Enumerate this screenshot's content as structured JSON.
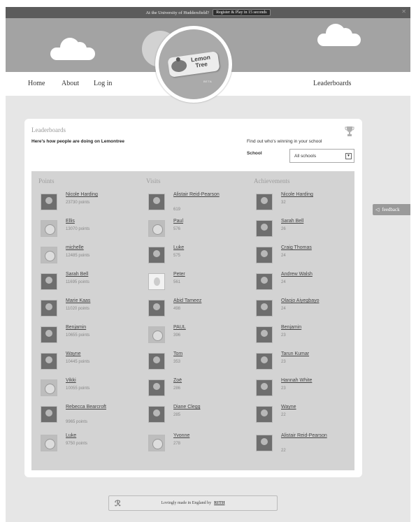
{
  "promo": {
    "text": "At the University of Huddersfield?",
    "button": "Register & Play in 15 seconds"
  },
  "nav": {
    "home": "Home",
    "about": "About",
    "login": "Log in",
    "leaderboards": "Leaderboards"
  },
  "logo": {
    "line1": "Lemon",
    "line2": "Tree",
    "beta": "BETA"
  },
  "feedback": "feedback",
  "card": {
    "title": "Leaderboards",
    "subtitle": "Here's how people are doing on Lemontree",
    "find_out": "Find out who's winning in your school",
    "school_label": "School",
    "school_value": "All schools"
  },
  "columns": [
    {
      "title": "Points",
      "entries": [
        {
          "name": "Nicole Harding",
          "score": "23730 points",
          "pic": "photo"
        },
        {
          "name": "Ellis",
          "score": "13070 points",
          "pic": "lemon"
        },
        {
          "name": "michelle",
          "score": "12485 points",
          "pic": "lemon"
        },
        {
          "name": "Sarah Bell",
          "score": "11695 points",
          "pic": "photo"
        },
        {
          "name": "Marie Kaas",
          "score": "11020 points",
          "pic": "photo"
        },
        {
          "name": "Benjamin",
          "score": "10655 points",
          "pic": "photo"
        },
        {
          "name": "Wayne",
          "score": "10445 points",
          "pic": "photo"
        },
        {
          "name": "Vikki",
          "score": "10055 points",
          "pic": "lemon"
        },
        {
          "name": "Rebecca Bearcroft",
          "score": "9965 points",
          "pic": "photo"
        },
        {
          "name": "Luke",
          "score": "9750 points",
          "pic": "lemon"
        }
      ]
    },
    {
      "title": "Visits",
      "entries": [
        {
          "name": "Alistair Reid-Pearson",
          "score": "619",
          "pic": "photo"
        },
        {
          "name": "Paul",
          "score": "576",
          "pic": "lemon"
        },
        {
          "name": "Luke",
          "score": "575",
          "pic": "photo"
        },
        {
          "name": "Peter",
          "score": "561",
          "pic": "blank"
        },
        {
          "name": "Abid Tameez",
          "score": "498",
          "pic": "photo"
        },
        {
          "name": "PAUL",
          "score": "396",
          "pic": "lemon"
        },
        {
          "name": "Tom",
          "score": "353",
          "pic": "photo"
        },
        {
          "name": "Zoë",
          "score": "286",
          "pic": "photo"
        },
        {
          "name": "Diane Clegg",
          "score": "285",
          "pic": "photo"
        },
        {
          "name": "Yvonne",
          "score": "278",
          "pic": "lemon"
        }
      ]
    },
    {
      "title": "Achievements",
      "entries": [
        {
          "name": "Nicole Harding",
          "score": "32",
          "pic": "photo"
        },
        {
          "name": "Sarah Bell",
          "score": "26",
          "pic": "photo"
        },
        {
          "name": "Craig Thomas",
          "score": "24",
          "pic": "photo"
        },
        {
          "name": "Andrew Walsh",
          "score": "24",
          "pic": "photo"
        },
        {
          "name": "Olaojo Aiyegbayo",
          "score": "24",
          "pic": "photo"
        },
        {
          "name": "Benjamin",
          "score": "23",
          "pic": "photo"
        },
        {
          "name": "Tarun Kumar",
          "score": "23",
          "pic": "photo"
        },
        {
          "name": "Hannah White",
          "score": "23",
          "pic": "photo"
        },
        {
          "name": "Wayne",
          "score": "22",
          "pic": "photo"
        },
        {
          "name": "Alistair Reid-Pearson",
          "score": "22",
          "pic": "photo"
        }
      ]
    }
  ],
  "footer": {
    "text": "Lovingly made in England by",
    "link": "RITH"
  }
}
